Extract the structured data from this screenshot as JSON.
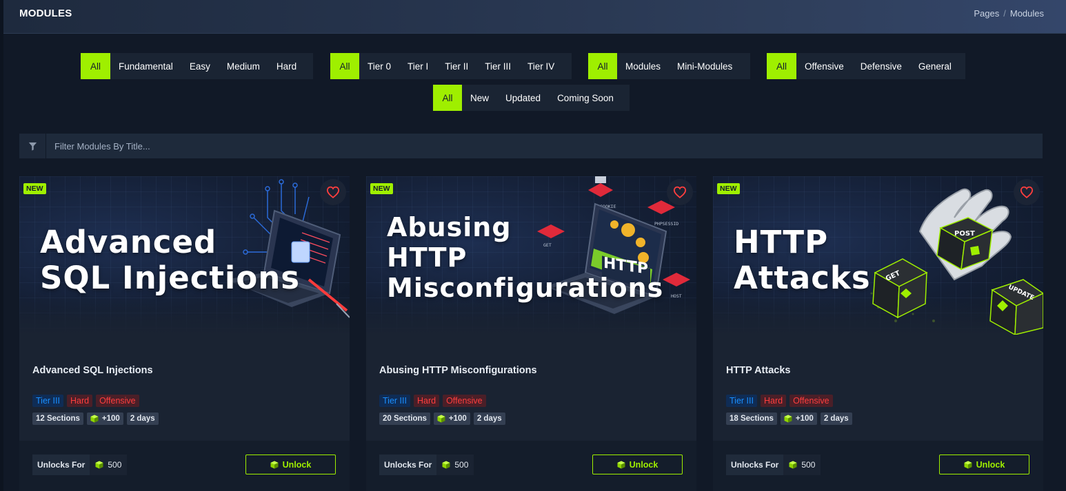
{
  "header": {
    "title": "MODULES",
    "breadcrumb": [
      "Pages",
      "Modules"
    ],
    "breadcrumb_separator": "/"
  },
  "filters": {
    "difficulty": [
      "All",
      "Fundamental",
      "Easy",
      "Medium",
      "Hard"
    ],
    "tier": [
      "All",
      "Tier 0",
      "Tier I",
      "Tier II",
      "Tier III",
      "Tier IV"
    ],
    "type": [
      "All",
      "Modules",
      "Mini-Modules"
    ],
    "category": [
      "All",
      "Offensive",
      "Defensive",
      "General"
    ],
    "status": [
      "All",
      "New",
      "Updated",
      "Coming Soon"
    ]
  },
  "search": {
    "placeholder": "Filter Modules By Title..."
  },
  "colors": {
    "accent": "#9fef00",
    "tier": "#1a8fff",
    "danger": "#ff3e3e",
    "heart": "#ff3e3e"
  },
  "cards": [
    {
      "badge": "NEW",
      "image_title_lines": [
        "Advanced",
        "SQL Injections"
      ],
      "title": "Advanced SQL Injections",
      "tags": [
        "Tier III",
        "Hard",
        "Offensive"
      ],
      "sections": "12 Sections",
      "points": "+100",
      "duration": "2 days",
      "unlocks_label": "Unlocks For",
      "unlock_cost": "500",
      "unlock_button": "Unlock"
    },
    {
      "badge": "NEW",
      "image_title_lines": [
        "Abusing",
        "HTTP",
        "Misconfigurations"
      ],
      "image_art_labels": [
        "GET",
        "HOST",
        "PHPSESSID",
        "COOKIE"
      ],
      "image_art_text": "HTTP",
      "title": "Abusing HTTP Misconfigurations",
      "tags": [
        "Tier III",
        "Hard",
        "Offensive"
      ],
      "sections": "20 Sections",
      "points": "+100",
      "duration": "2 days",
      "unlocks_label": "Unlocks For",
      "unlock_cost": "500",
      "unlock_button": "Unlock"
    },
    {
      "badge": "NEW",
      "image_title_lines": [
        "HTTP",
        "Attacks"
      ],
      "image_art_labels": [
        "POST",
        "GET",
        "UPDATE"
      ],
      "title": "HTTP Attacks",
      "tags": [
        "Tier III",
        "Hard",
        "Offensive"
      ],
      "sections": "18 Sections",
      "points": "+100",
      "duration": "2 days",
      "unlocks_label": "Unlocks For",
      "unlock_cost": "500",
      "unlock_button": "Unlock"
    }
  ]
}
